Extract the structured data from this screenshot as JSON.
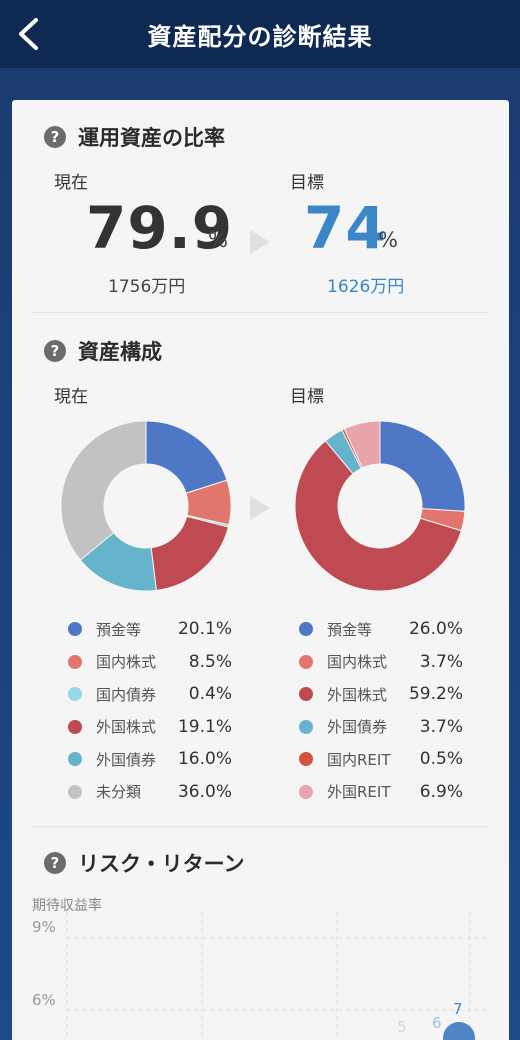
{
  "header": {
    "title": "資産配分の診断結果"
  },
  "ratio": {
    "section_title": "運用資産の比率",
    "current": {
      "label": "現在",
      "value": "79.9",
      "unit": "%",
      "amount": "1756万円"
    },
    "target": {
      "label": "目標",
      "value": "74",
      "unit": "%",
      "amount": "1626万円"
    }
  },
  "composition": {
    "section_title": "資産構成",
    "current_label": "現在",
    "target_label": "目標",
    "current_items": [
      {
        "name": "預金等",
        "value": "20.1%",
        "color": "#4e77c6",
        "pct": 20.1
      },
      {
        "name": "国内株式",
        "value": "8.5%",
        "color": "#e2766c",
        "pct": 8.5
      },
      {
        "name": "国内債券",
        "value": "0.4%",
        "color": "#94d8ea",
        "pct": 0.4
      },
      {
        "name": "外国株式",
        "value": "19.1%",
        "color": "#c04a52",
        "pct": 19.1
      },
      {
        "name": "外国債券",
        "value": "16.0%",
        "color": "#66b4cc",
        "pct": 16.0
      },
      {
        "name": "未分類",
        "value": "36.0%",
        "color": "#c2c2c2",
        "pct": 36.0
      }
    ],
    "target_items": [
      {
        "name": "預金等",
        "value": "26.0%",
        "color": "#4e77c6",
        "pct": 26.0
      },
      {
        "name": "国内株式",
        "value": "3.7%",
        "color": "#e2766c",
        "pct": 3.7
      },
      {
        "name": "外国株式",
        "value": "59.2%",
        "color": "#c04a52",
        "pct": 59.2
      },
      {
        "name": "外国債券",
        "value": "3.7%",
        "color": "#66b4cc",
        "pct": 3.7
      },
      {
        "name": "国内REIT",
        "value": "0.5%",
        "color": "#d4513f",
        "pct": 0.5
      },
      {
        "name": "外国REIT",
        "value": "6.9%",
        "color": "#e8a5ac",
        "pct": 6.9
      }
    ]
  },
  "risk": {
    "section_title": "リスク・リターン",
    "ylabel": "期待収益率",
    "ticks": [
      "9%",
      "6%"
    ],
    "point_labels": [
      "7",
      "6",
      "5"
    ]
  }
}
